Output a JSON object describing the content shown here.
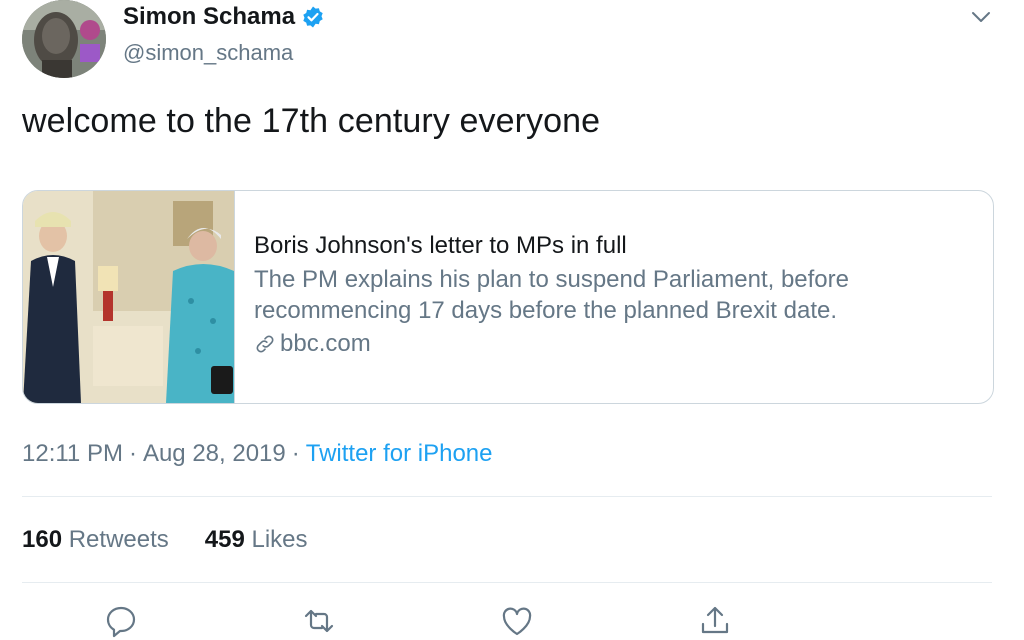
{
  "author": {
    "name": "Simon Schama",
    "handle": "@simon_schama",
    "avatar_icon": "profile-photo",
    "verified_icon": "verified-badge-icon"
  },
  "tweet": {
    "text": "welcome to the 17th century everyone"
  },
  "card": {
    "title": "Boris Johnson's letter to MPs in full",
    "description_line1": "The PM explains his plan to suspend Parliament, before",
    "description_line2": "recommencing 17 days before the planned Brexit date.",
    "domain": "bbc.com",
    "link_icon": "link-icon"
  },
  "meta": {
    "time": "12:11 PM",
    "date": "Aug 28, 2019",
    "separator": "·",
    "source": "Twitter for iPhone"
  },
  "stats": {
    "retweets_count": "160",
    "retweets_label": "Retweets",
    "likes_count": "459",
    "likes_label": "Likes"
  },
  "actions": [
    "reply-icon",
    "retweet-icon",
    "like-icon",
    "share-icon"
  ],
  "colors": {
    "accent": "#1da1f2",
    "text": "#14171a",
    "secondary": "#657786",
    "border": "#ccd6dd"
  }
}
